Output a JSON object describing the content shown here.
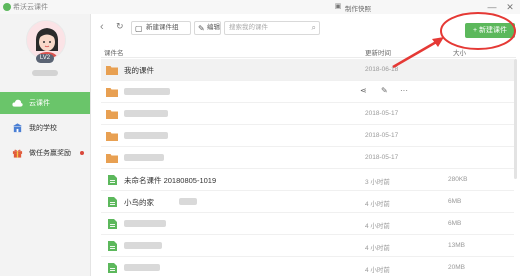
{
  "app": {
    "title": "希沃云课件"
  },
  "window": {
    "screenshot_label": "制作快照",
    "minimize": "—",
    "close": "✕"
  },
  "user": {
    "level": "LV2"
  },
  "sidebar": {
    "items": [
      {
        "label": "云课件",
        "icon": "cloud-icon",
        "active": true
      },
      {
        "label": "我的学校",
        "icon": "school-icon",
        "active": false
      },
      {
        "label": "做任务赢奖励",
        "icon": "gift-icon",
        "active": false,
        "badge_color": "#d9483b"
      }
    ]
  },
  "toolbar": {
    "back": "‹",
    "refresh": "↻",
    "new_group": "新建课件组",
    "edit": "编辑",
    "search_placeholder": "搜索我的课件",
    "new_course": "+ 新建课件"
  },
  "table": {
    "headers": {
      "name": "课件名",
      "date": "更新时间",
      "size": "大小"
    },
    "rows": [
      {
        "type": "folder",
        "name": "我的课件",
        "date": "2018-06-18",
        "size": ""
      },
      {
        "type": "folder",
        "name": "",
        "date": "",
        "size": "",
        "hovered": true
      },
      {
        "type": "folder",
        "name": "",
        "date": "2018-05-17",
        "size": ""
      },
      {
        "type": "folder",
        "name": "",
        "date": "2018-05-17",
        "size": ""
      },
      {
        "type": "folder",
        "name": "",
        "date": "2018-05-17",
        "size": ""
      },
      {
        "type": "file",
        "name": "未命名课件 20180805-1019",
        "date": "3 小时前",
        "size": "280KB"
      },
      {
        "type": "file",
        "name": "小鸟的家",
        "date": "4 小时前",
        "size": "6MB"
      },
      {
        "type": "file",
        "name": "",
        "date": "4 小时前",
        "size": "6MB"
      },
      {
        "type": "file",
        "name": "",
        "date": "4 小时前",
        "size": "13MB"
      },
      {
        "type": "file",
        "name": "",
        "date": "4 小时前",
        "size": "20MB"
      }
    ]
  },
  "row_actions": {
    "share": "share-icon",
    "rename": "pencil-icon",
    "more": "···"
  },
  "colors": {
    "accent": "#5cb85c",
    "sidebar_active": "#6ac56a",
    "folder": "#e8a052",
    "file": "#5cb85c",
    "annotation_red": "#e53935"
  }
}
